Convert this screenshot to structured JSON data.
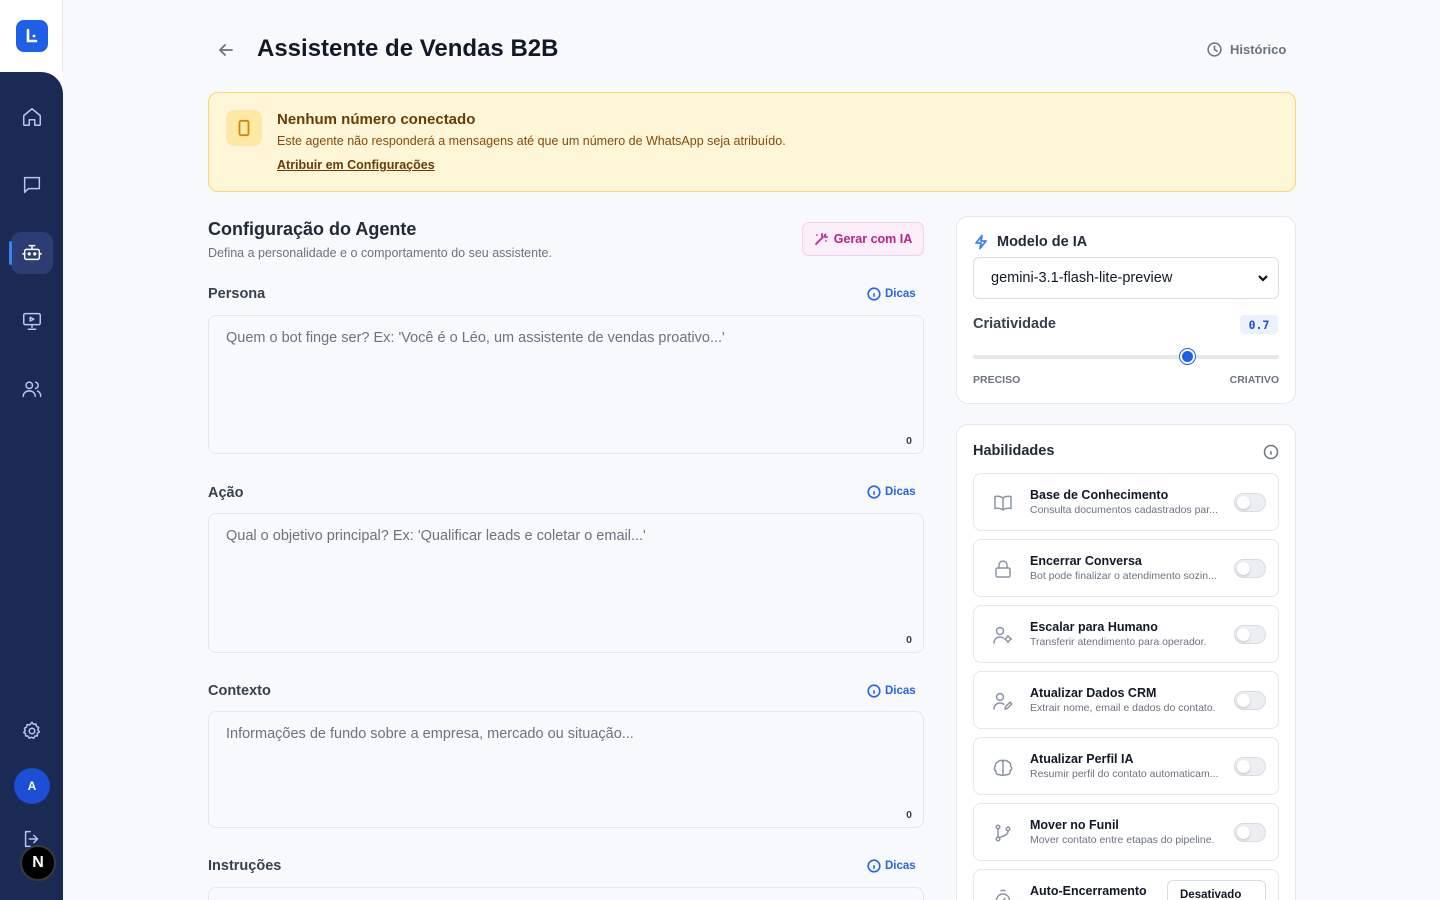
{
  "page": {
    "title": "Assistente de Vendas B2B",
    "history_label": "Histórico"
  },
  "sidebar": {
    "logo": "L",
    "avatar_initial": "A",
    "badge": "N",
    "items": [
      {
        "icon": "home-icon"
      },
      {
        "icon": "chat-icon"
      },
      {
        "icon": "bot-icon",
        "active": true
      },
      {
        "icon": "presentation-icon"
      },
      {
        "icon": "users-icon"
      },
      {
        "icon": "gear-icon"
      },
      {
        "icon": "logout-icon"
      }
    ]
  },
  "alert": {
    "title": "Nenhum número conectado",
    "text": "Este agente não responderá a mensagens até que um número de WhatsApp seja atribuído.",
    "link": "Atribuir em Configurações"
  },
  "config": {
    "title": "Configuração do Agente",
    "subtitle": "Defina a personalidade e o comportamento do seu assistente.",
    "generate_label": "Gerar com IA",
    "tips_label": "Dicas",
    "fields": [
      {
        "label": "Persona",
        "placeholder": "Quem o bot finge ser? Ex: 'Você é o Léo, um assistente de vendas proativo...'",
        "count": "0"
      },
      {
        "label": "Ação",
        "placeholder": "Qual o objetivo principal? Ex: 'Qualificar leads e coletar o email...'",
        "count": "0"
      },
      {
        "label": "Contexto",
        "placeholder": "Informações de fundo sobre a empresa, mercado ou situação...",
        "count": "0"
      },
      {
        "label": "Instruções"
      }
    ]
  },
  "model": {
    "title": "Modelo de IA",
    "selected": "gemini-3.1-flash-lite-preview",
    "creativity_label": "Criatividade",
    "creativity_value": "0.7",
    "creativity": 0.7,
    "min_label": "PRECISO",
    "max_label": "CRIATIVO"
  },
  "skills": {
    "title": "Habilidades",
    "items": [
      {
        "name": "Base de Conhecimento",
        "desc": "Consulta documentos cadastrados par...",
        "icon": "book-icon",
        "enabled": false
      },
      {
        "name": "Encerrar Conversa",
        "desc": "Bot pode finalizar o atendimento sozin...",
        "icon": "lock-icon",
        "enabled": false
      },
      {
        "name": "Escalar para Humano",
        "desc": "Transferir atendimento para operador.",
        "icon": "user-cog-icon",
        "enabled": false
      },
      {
        "name": "Atualizar Dados CRM",
        "desc": "Extrair nome, email e dados do contato.",
        "icon": "user-pen-icon",
        "enabled": false
      },
      {
        "name": "Atualizar Perfil IA",
        "desc": "Resumir perfil do contato automaticam...",
        "icon": "brain-icon",
        "enabled": false
      },
      {
        "name": "Mover no Funil",
        "desc": "Mover contato entre etapas do pipeline.",
        "icon": "git-branch-icon",
        "enabled": false
      },
      {
        "name": "Auto-Encerramento",
        "icon": "timer-icon",
        "select_value": "Desativado"
      }
    ]
  }
}
